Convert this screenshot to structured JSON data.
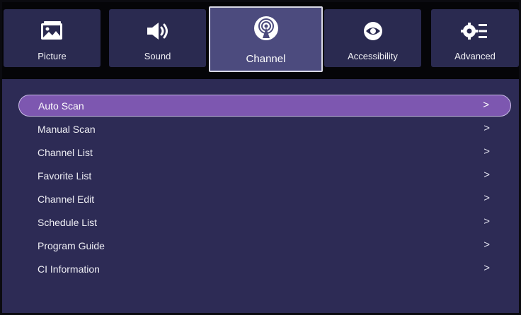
{
  "tabs": [
    {
      "label": "Picture",
      "icon": "picture-icon"
    },
    {
      "label": "Sound",
      "icon": "speaker-icon"
    },
    {
      "label": "Channel",
      "icon": "antenna-icon"
    },
    {
      "label": "Accessibility",
      "icon": "eye-icon"
    },
    {
      "label": "Advanced",
      "icon": "gear-list-icon"
    }
  ],
  "active_tab": "Channel",
  "menu": {
    "items": [
      {
        "label": "Auto Scan",
        "chevron": ">"
      },
      {
        "label": "Manual Scan",
        "chevron": ">"
      },
      {
        "label": "Channel List",
        "chevron": ">"
      },
      {
        "label": "Favorite List",
        "chevron": ">"
      },
      {
        "label": "Channel Edit",
        "chevron": ">"
      },
      {
        "label": "Schedule List",
        "chevron": ">"
      },
      {
        "label": "Program Guide",
        "chevron": ">"
      },
      {
        "label": "CI Information",
        "chevron": ">"
      }
    ],
    "selected_item": "Auto Scan"
  },
  "colors": {
    "background": "#2d2b55",
    "tab_bar": "#050508",
    "tab": "#2a2a50",
    "tab_active": "#4c4b7e",
    "selection": "#7d57b0"
  }
}
